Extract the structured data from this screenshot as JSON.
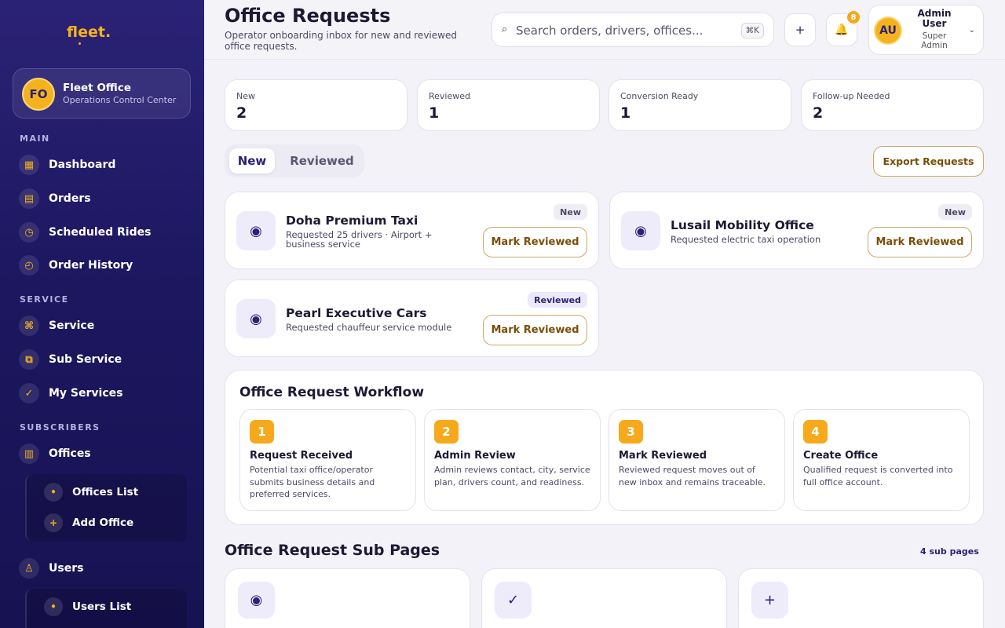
{
  "sidebar": {
    "brand": "fleet.",
    "org": {
      "initials": "FO",
      "name": "Fleet Office",
      "subtitle": "Operations Control Center"
    },
    "sections": {
      "main": "MAIN",
      "service": "SERVICE",
      "subscribers": "SUBSCRIBERS"
    },
    "items": {
      "dashboard": "Dashboard",
      "orders": "Orders",
      "scheduled_rides": "Scheduled Rides",
      "order_history": "Order History",
      "service": "Service",
      "sub_service": "Sub Service",
      "my_services": "My Services",
      "offices": "Offices",
      "offices_list": "Offices List",
      "add_office": "Add Office",
      "users": "Users",
      "users_list": "Users List"
    },
    "icons": {
      "dashboard": "▦",
      "orders": "▤",
      "scheduled_rides": "◷",
      "order_history": "◴",
      "service": "⌘",
      "sub_service": "⧉",
      "my_services": "✓",
      "offices": "▥",
      "offices_list": "•",
      "add_office": "+",
      "users": "♙",
      "users_list": "•"
    }
  },
  "header": {
    "title": "Office Requests",
    "subtitle": "Operator onboarding inbox for new and reviewed office requests.",
    "search_placeholder": "Search orders, drivers, offices...",
    "search_shortcut": "⌘K",
    "add_icon": "+",
    "bell_icon": "🔔",
    "notification_count": "8",
    "user": {
      "initials": "AU",
      "name": "Admin User",
      "role": "Super Admin"
    }
  },
  "stats": [
    {
      "label": "New",
      "value": "2"
    },
    {
      "label": "Reviewed",
      "value": "1"
    },
    {
      "label": "Conversion Ready",
      "value": "1"
    },
    {
      "label": "Follow-up Needed",
      "value": "2"
    }
  ],
  "tabs": {
    "new": "New",
    "reviewed": "Reviewed",
    "selected": "New"
  },
  "export_label": "Export Requests",
  "requests": [
    {
      "name": "Doha Premium Taxi",
      "desc": "Requested 25 drivers · Airport + business service",
      "badge": "New",
      "action": "Mark Reviewed"
    },
    {
      "name": "Lusail Mobility Office",
      "desc": "Requested electric taxi operation",
      "badge": "New",
      "action": "Mark Reviewed"
    },
    {
      "name": "Pearl Executive Cars",
      "desc": "Requested chauffeur service module",
      "badge": "Reviewed",
      "action": "Mark Reviewed"
    }
  ],
  "workflow": {
    "title": "Office Request Workflow",
    "steps": [
      {
        "num": "1",
        "title": "Request Received",
        "desc": "Potential taxi office/operator submits business details and preferred services."
      },
      {
        "num": "2",
        "title": "Admin Review",
        "desc": "Admin reviews contact, city, service plan, drivers count, and readiness."
      },
      {
        "num": "3",
        "title": "Mark Reviewed",
        "desc": "Reviewed request moves out of new inbox and remains traceable."
      },
      {
        "num": "4",
        "title": "Create Office",
        "desc": "Qualified request is converted into full office account."
      }
    ]
  },
  "sub_pages": {
    "title": "Office Request Sub Pages",
    "count": "4 sub pages",
    "icons": [
      "◉",
      "✓",
      "+"
    ]
  },
  "colors": {
    "accent": "#f5a91b",
    "brand": "#2b2276",
    "action_text": "#7a4e06"
  }
}
